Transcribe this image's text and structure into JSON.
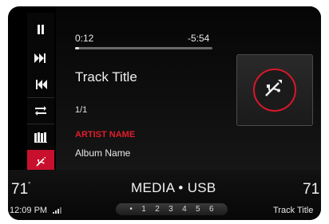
{
  "player": {
    "elapsed": "0:12",
    "remaining": "-5:54",
    "progress_fraction": 0.03,
    "track_title": "Track Title",
    "track_count": "1/1",
    "artist": "ARTIST NAME",
    "album": "Album Name",
    "source_icon": "usb-icon"
  },
  "sidebar": {
    "items": [
      {
        "icon": "pause-icon"
      },
      {
        "icon": "skip-forward-icon"
      },
      {
        "icon": "skip-back-icon"
      },
      {
        "icon": "repeat-icon"
      },
      {
        "icon": "browse-icon"
      },
      {
        "icon": "usb-icon",
        "active": true
      }
    ]
  },
  "status": {
    "temp_left": "71",
    "temp_right": "71",
    "source_label": "MEDIA • USB",
    "clock": "12:09 PM",
    "presets": [
      "•",
      "1",
      "2",
      "3",
      "4",
      "5",
      "6"
    ],
    "bottom_track": "Track Title"
  },
  "colors": {
    "accent": "#c8102e",
    "background": "#000000"
  }
}
